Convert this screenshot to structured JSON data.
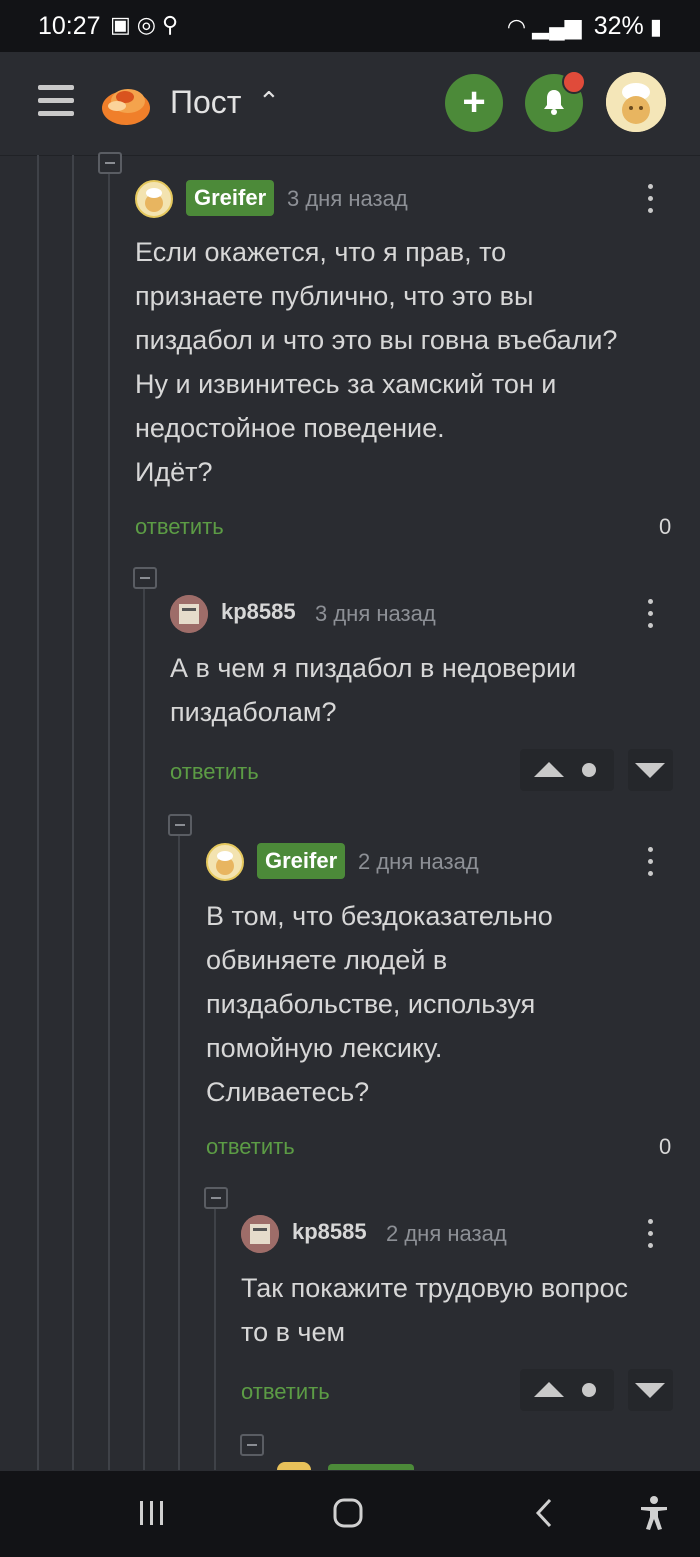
{
  "status_bar": {
    "time": "10:27",
    "battery": "32%"
  },
  "header": {
    "title": "Пост",
    "add_label": "+",
    "colors": {
      "accent": "#4c8a39",
      "notify": "#e04b3a"
    }
  },
  "comments": [
    {
      "author": "Greifer",
      "time": "3 дня назад",
      "text": [
        "Если окажется, что я прав, то",
        "признаете публично, что это вы",
        "пиздабол и что это вы говна въебали?",
        "Ну и извинитесь за хамский тон и",
        "недостойное поведение.",
        "Идёт?"
      ],
      "reply": "ответить",
      "score": "0"
    },
    {
      "author": "kp8585",
      "time": "3 дня назад",
      "text": [
        "А в чем я пиздабол в недоверии",
        "пиздаболам?"
      ],
      "reply": "ответить"
    },
    {
      "author": "Greifer",
      "time": "2 дня назад",
      "text": [
        "В том, что бездоказательно",
        "обвиняете людей в",
        "пиздабольстве, используя",
        "помойную лексику.",
        "Сливаетесь?"
      ],
      "reply": "ответить",
      "score": "0"
    },
    {
      "author": "kp8585",
      "time": "2 дня назад",
      "text": [
        "Так покажите трудовую вопрос",
        "то в чем"
      ],
      "reply": "ответить"
    }
  ]
}
